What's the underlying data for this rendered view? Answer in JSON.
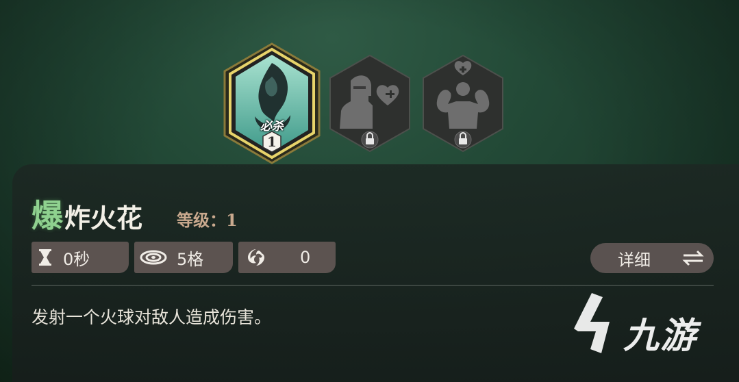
{
  "skills": [
    {
      "id": "main",
      "label": "必杀",
      "level": "1",
      "state": "selected",
      "icon": "dark-flame-icon"
    },
    {
      "id": "locked-1",
      "state": "locked",
      "icon": "knight-heart-icon"
    },
    {
      "id": "locked-2",
      "state": "locked",
      "icon": "muscle-heart-icon"
    }
  ],
  "skill_info": {
    "name_first": "爆",
    "name_rest": "炸火花",
    "level_text": "等级：1",
    "stats": {
      "cooldown": {
        "icon": "hourglass-icon",
        "value": "0秒"
      },
      "range": {
        "icon": "range-icon",
        "value": "5格"
      },
      "cost": {
        "icon": "energy-swirl-icon",
        "value": "0"
      }
    },
    "detail_button": {
      "label": "详细",
      "icon": "swap-arrows-icon"
    },
    "description": "发射一个火球对敌人造成伤害。"
  },
  "watermark": {
    "text": "九游",
    "icon": "jiuyou-logo-icon"
  },
  "colors": {
    "accent_green": "#8fd18f",
    "selected_border": "#e7d36a",
    "stat_bg": "#5c5350",
    "level_text": "#c9a98e"
  }
}
